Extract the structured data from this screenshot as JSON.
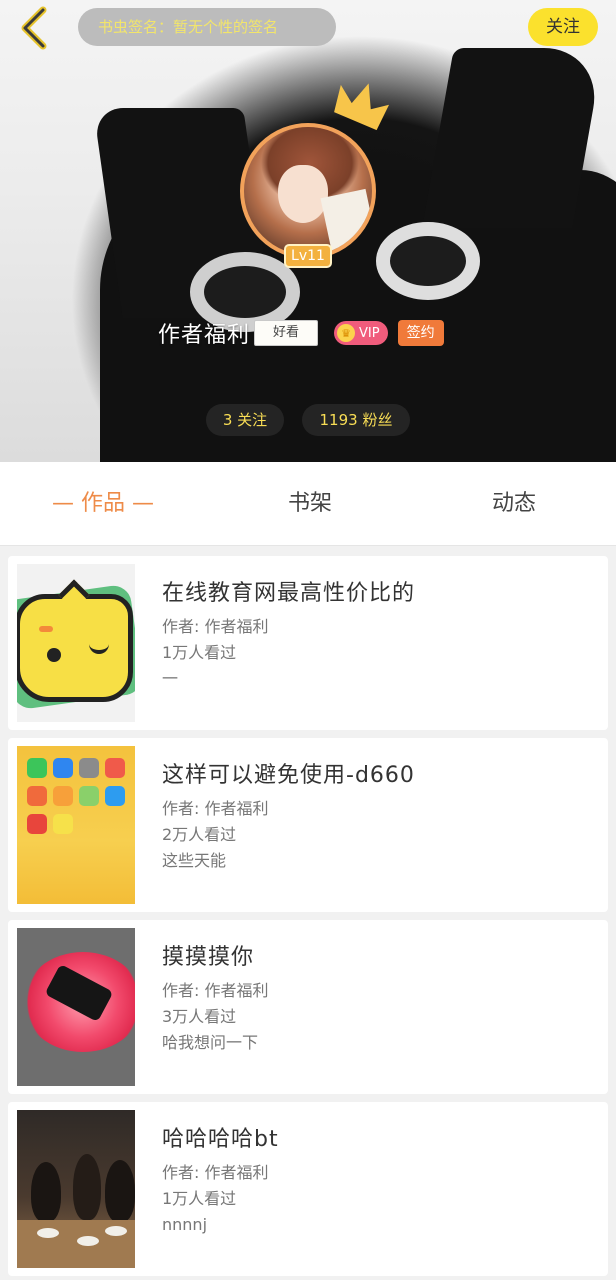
{
  "header": {
    "signature": "书虫签名：暂无个性的签名",
    "follow_label": "关注",
    "level": "Lv11",
    "author_name": "作者福利",
    "good_tag": "好看",
    "vip_label": "VIP",
    "signed_label": "签约",
    "following_count": "3 关注",
    "fans_count": "1193 粉丝"
  },
  "tabs": [
    {
      "label": "— 作品 —",
      "active": true
    },
    {
      "label": "书架",
      "active": false
    },
    {
      "label": "动态",
      "active": false
    }
  ],
  "works": [
    {
      "title": "在线教育网最高性价比的",
      "author": "作者: 作者福利",
      "views": "1万人看过",
      "desc": "一",
      "cover_icon": "chat-bubble-cover"
    },
    {
      "title": "这样可以避免使用-d660",
      "author": "作者: 作者福利",
      "views": "2万人看过",
      "desc": "这些天能",
      "cover_icon": "phone-homescreen-cover"
    },
    {
      "title": "摸摸摸你",
      "author": "作者: 作者福利",
      "views": "3万人看过",
      "desc": "哈我想问一下",
      "cover_icon": "glowing-circle-cover"
    },
    {
      "title": "哈哈哈哈bt",
      "author": "作者: 作者福利",
      "views": "1万人看过",
      "desc": "nnnnj",
      "cover_icon": "dinner-party-cover"
    }
  ],
  "colors": {
    "accent_yellow": "#fbe12d",
    "tab_active": "#ee8b48",
    "vip": "#f05c7c",
    "signed": "#f07a3a"
  }
}
